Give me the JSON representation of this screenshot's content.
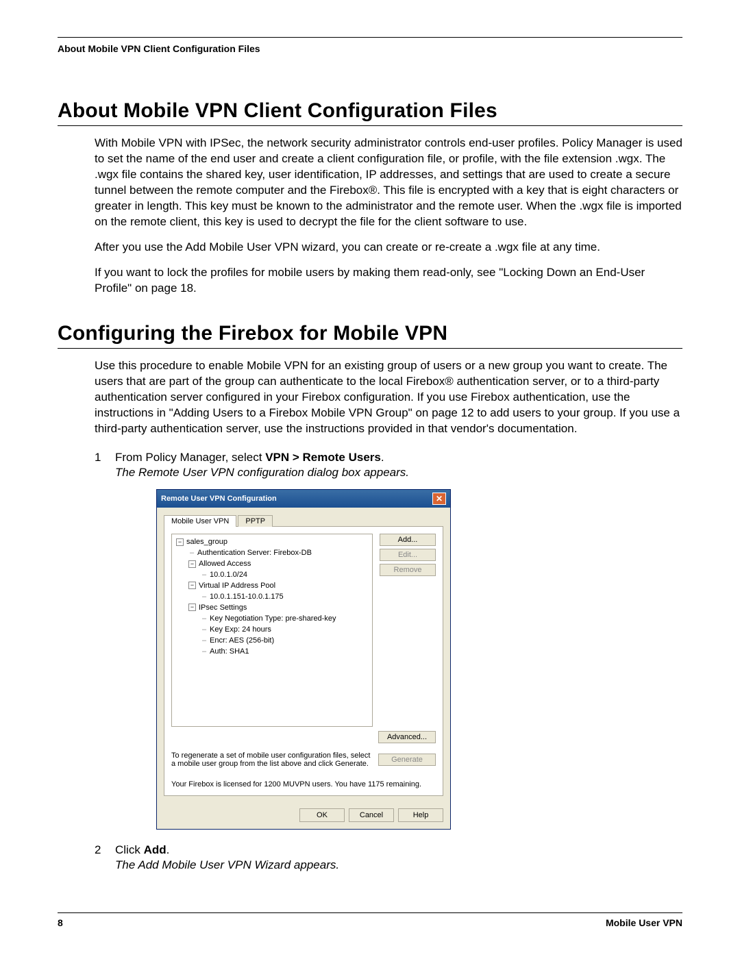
{
  "header": {
    "running_head": "About Mobile VPN Client Configuration Files"
  },
  "section1": {
    "title": "About Mobile VPN Client Configuration Files",
    "p1": "With Mobile VPN with IPSec, the network security administrator controls end-user profiles. Policy Manager is used to set the name of the end user and create a client configuration file, or profile, with the file extension .wgx. The .wgx file contains the shared key, user identification, IP addresses, and settings that are used to create a secure tunnel between the remote computer and the Firebox®. This file is encrypted with a key that is eight characters or greater in length. This key must be known to the administrator and the remote user. When the .wgx file is imported on the remote client, this key is used to decrypt the file for the client software to use.",
    "p2": "After you use the Add Mobile User VPN wizard, you can create or re-create a .wgx file at any time.",
    "p3": "If you want to lock the profiles for mobile users by making them read-only, see \"Locking Down an End-User Profile\" on page 18."
  },
  "section2": {
    "title": "Configuring the Firebox for Mobile VPN",
    "p1": "Use this procedure to enable Mobile VPN for an existing group of users or a new group you want to create. The users that are part of the group can authenticate to the local Firebox® authentication server, or to a third-party authentication server configured in your Firebox configuration. If you use Firebox authentication, use the instructions in \"Adding Users to a Firebox Mobile VPN Group\" on page 12 to add users to your group. If you use a third-party authentication server, use the instructions provided in that vendor's documentation.",
    "step1_num": "1",
    "step1_a": "From Policy Manager, select ",
    "step1_b": "VPN > Remote Users",
    "step1_c": ".",
    "step1_note": "The Remote User VPN configuration dialog box appears.",
    "step2_num": "2",
    "step2_a": "Click ",
    "step2_b": "Add",
    "step2_c": ".",
    "step2_note": "The Add Mobile User VPN Wizard appears."
  },
  "dialog": {
    "title": "Remote User VPN Configuration",
    "close_glyph": "✕",
    "tabs": {
      "active": "Mobile User VPN",
      "other": "PPTP"
    },
    "tree": {
      "root": "sales_group",
      "auth": "Authentication Server: Firebox-DB",
      "allowed": "Allowed Access",
      "allowed_item": "10.0.1.0/24",
      "vip": "Virtual IP Address Pool",
      "vip_item": "10.0.1.151-10.0.1.175",
      "ipsec": "IPsec Settings",
      "ipsec_items": {
        "k1": "Key Negotiation Type: pre-shared-key",
        "k2": "Key Exp: 24 hours",
        "k3": "Encr: AES (256-bit)",
        "k4": "Auth: SHA1"
      }
    },
    "buttons": {
      "add": "Add...",
      "edit": "Edit...",
      "remove": "Remove",
      "advanced": "Advanced...",
      "generate": "Generate"
    },
    "generate_text": "To regenerate a set of mobile user configuration files, select a mobile user group from the list above and click Generate.",
    "license_text": "Your Firebox is licensed for 1200 MUVPN users. You have 1175 remaining.",
    "footer_buttons": {
      "ok": "OK",
      "cancel": "Cancel",
      "help": "Help"
    }
  },
  "footer": {
    "page": "8",
    "doc": "Mobile User VPN"
  }
}
